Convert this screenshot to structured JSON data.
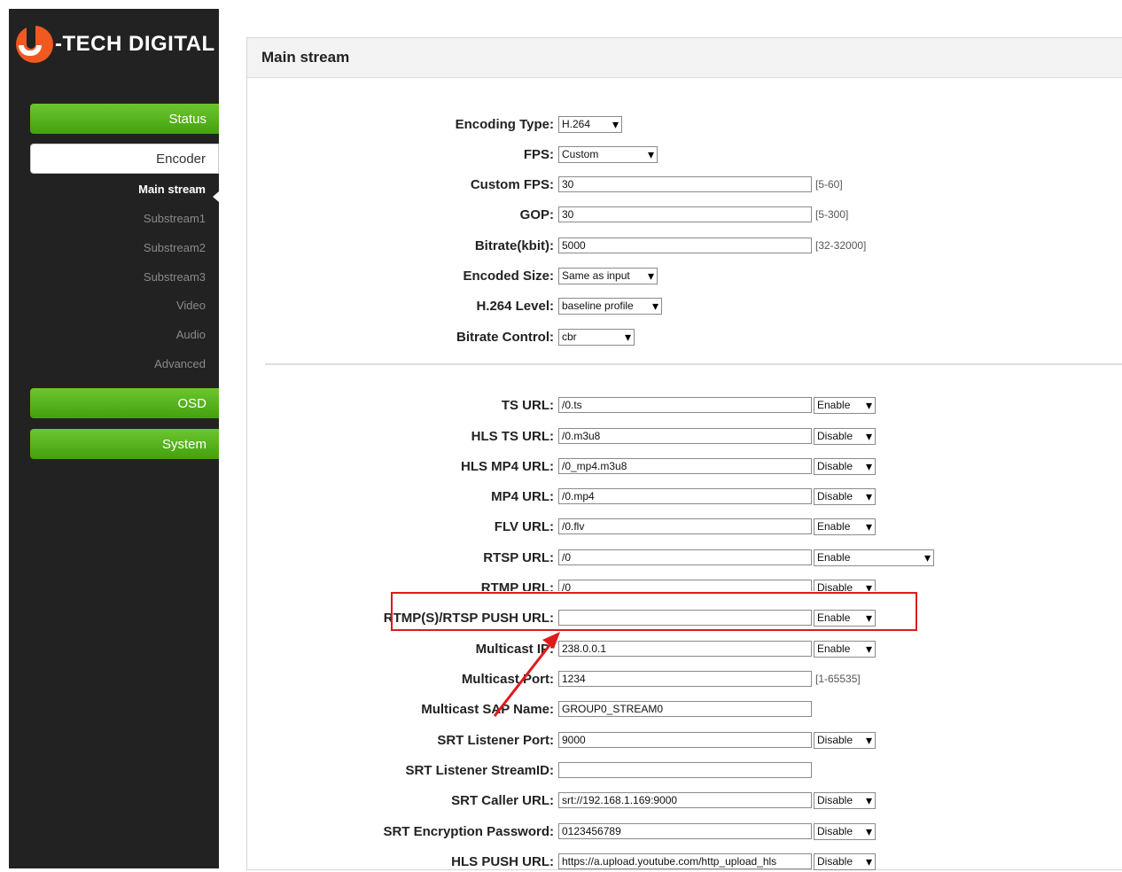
{
  "brand": {
    "logo_text": "-TECH DIGITAL"
  },
  "sidebar": {
    "menu": {
      "status": "Status",
      "encoder": "Encoder",
      "osd": "OSD",
      "system": "System"
    },
    "submenu": {
      "main_stream": "Main stream",
      "substream1": "Substream1",
      "substream2": "Substream2",
      "substream3": "Substream3",
      "video": "Video",
      "audio": "Audio",
      "advanced": "Advanced"
    }
  },
  "panel": {
    "title": "Main stream"
  },
  "encoding": {
    "encoding_type": {
      "label": "Encoding Type:",
      "value": "H.264"
    },
    "fps": {
      "label": "FPS:",
      "value": "Custom"
    },
    "custom_fps": {
      "label": "Custom FPS:",
      "value": "30",
      "hint": "[5-60]"
    },
    "gop": {
      "label": "GOP:",
      "value": "30",
      "hint": "[5-300]"
    },
    "bitrate": {
      "label": "Bitrate(kbit):",
      "value": "5000",
      "hint": "[32-32000]"
    },
    "encoded_size": {
      "label": "Encoded Size:",
      "value": "Same as input"
    },
    "h264_level": {
      "label": "H.264 Level:",
      "value": "baseline profile"
    },
    "bitrate_control": {
      "label": "Bitrate Control:",
      "value": "cbr"
    }
  },
  "urls": {
    "ts": {
      "label": "TS URL:",
      "value": "/0.ts",
      "state": "Enable"
    },
    "hls_ts": {
      "label": "HLS TS URL:",
      "value": "/0.m3u8",
      "state": "Disable"
    },
    "hls_mp4": {
      "label": "HLS MP4 URL:",
      "value": "/0_mp4.m3u8",
      "state": "Disable"
    },
    "mp4": {
      "label": "MP4 URL:",
      "value": "/0.mp4",
      "state": "Disable"
    },
    "flv": {
      "label": "FLV URL:",
      "value": "/0.flv",
      "state": "Enable"
    },
    "rtsp": {
      "label": "RTSP URL:",
      "value": "/0",
      "state": "Enable"
    },
    "rtmp": {
      "label": "RTMP URL:",
      "value": "/0",
      "state": "Disable"
    },
    "push": {
      "label": "RTMP(S)/RTSP PUSH URL:",
      "value": "",
      "state": "Enable"
    },
    "multicast_ip": {
      "label": "Multicast IP:",
      "value": "238.0.0.1",
      "state": "Enable"
    },
    "multicast_port": {
      "label": "Multicast Port:",
      "value": "1234",
      "hint": "[1-65535]"
    },
    "multicast_sap": {
      "label": "Multicast SAP Name:",
      "value": "GROUP0_STREAM0"
    },
    "srt_listener_port": {
      "label": "SRT Listener Port:",
      "value": "9000",
      "state": "Disable"
    },
    "srt_listener_streamid": {
      "label": "SRT Listener StreamID:",
      "value": ""
    },
    "srt_caller": {
      "label": "SRT Caller URL:",
      "value": "srt://192.168.1.169:9000",
      "state": "Disable"
    },
    "srt_password": {
      "label": "SRT Encryption Password:",
      "value": "0123456789",
      "state": "Disable"
    },
    "hls_push": {
      "label": "HLS PUSH URL:",
      "value": "https://a.upload.youtube.com/http_upload_hls",
      "state": "Disable"
    }
  },
  "colors": {
    "sidebar_bg": "#222222",
    "menu_green": "#52ad1a",
    "logo_orange": "#f0591f",
    "highlight_red": "#e01a1a"
  }
}
